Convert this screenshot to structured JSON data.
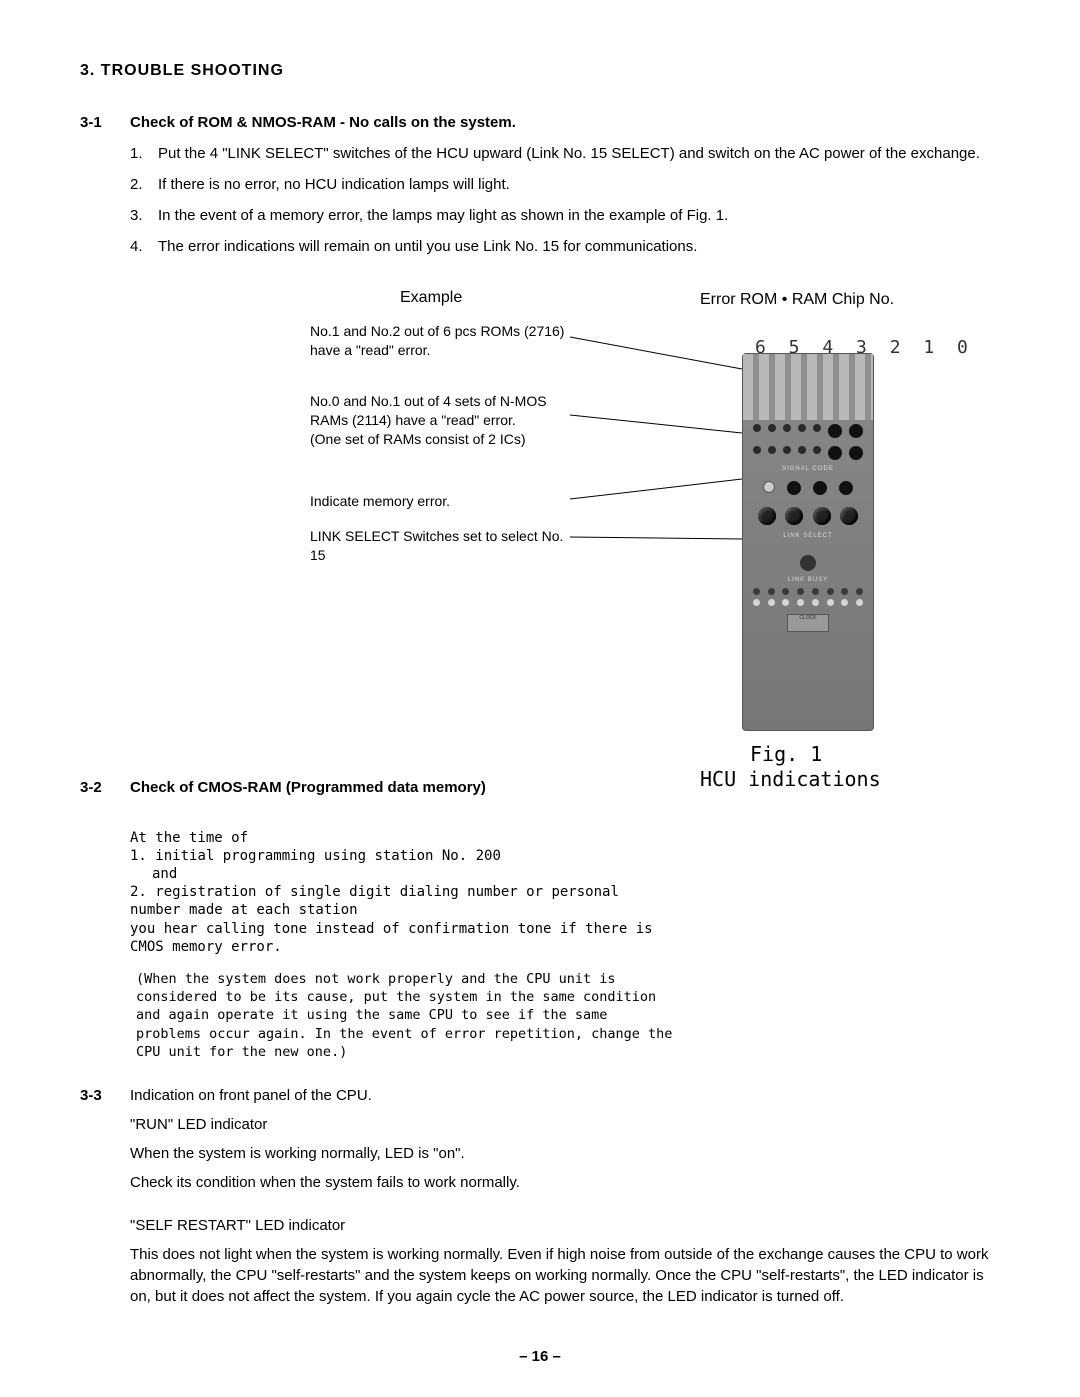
{
  "heading": "3.   TROUBLE  SHOOTING",
  "sec31": {
    "num": "3-1",
    "title": "Check of ROM & NMOS-RAM - No calls on the system.",
    "items": [
      {
        "n": "1.",
        "t": "Put the 4 \"LINK SELECT\" switches of the HCU upward (Link No. 15 SELECT) and switch on the AC power of the exchange."
      },
      {
        "n": "2.",
        "t": "If there is no error, no HCU indication lamps will light."
      },
      {
        "n": "3.",
        "t": "In the event of a memory error, the lamps may light as shown in the example of Fig. 1."
      },
      {
        "n": "4.",
        "t": "The error indications will remain on until you use Link No. 15 for communications."
      }
    ]
  },
  "example": {
    "label": "Example",
    "error_label": "Error ROM • RAM Chip No.",
    "chip_numbers": "6 5 4 3 2 1 0",
    "callouts": [
      "No.1 and No.2 out of 6 pcs ROMs (2716) have a \"read\" error.",
      "No.0 and No.1 out of 4 sets of N-MOS RAMs (2114) have a \"read\" error.\n(One set of RAMs consist of 2 ICs)",
      "Indicate memory error.",
      "LINK SELECT Switches set to select No. 15"
    ],
    "hcu_labels": {
      "signal": "SIGNAL  CODE",
      "link_select": "LINK  SELECT",
      "link_busy": "LINK  BUSY",
      "clock": "CLOCK"
    },
    "fig_label": "Fig. 1",
    "fig_caption": "HCU indications"
  },
  "sec32": {
    "num": "3-2",
    "title": "Check of CMOS-RAM (Programmed data memory)",
    "lead": "At the time of",
    "items": [
      {
        "n": "1.",
        "t": "initial programming using station No. 200",
        "tail": "and"
      },
      {
        "n": "2.",
        "t": "registration of single digit dialing number or personal number made at each station"
      }
    ],
    "trail": "you hear calling tone instead of confirmation tone if there is CMOS memory error.",
    "note": "(When the system does not work properly and the CPU unit is considered to be its cause, put the system in the same condition and again operate it using the same CPU to see if the same problems occur again.  In  the  event of error repetition, change the CPU unit for the new one.)"
  },
  "sec33": {
    "num": "3-3",
    "title": "Indication on front panel of the CPU.",
    "run_head": "\"RUN\" LED indicator",
    "run_l1": "When the system is working normally, LED is \"on\".",
    "run_l2": "Check its condition when the system fails to work normally.",
    "self_head": "\"SELF RESTART\" LED indicator",
    "self_body": "This does not light when the system is working normally.  Even if high noise from outside of the exchange causes the CPU to work abnormally, the CPU \"self-restarts\" and the system keeps on working normally.  Once the CPU \"self-restarts\", the LED indicator is on, but it does not affect the system.  If you again cycle the AC power source, the LED indicator is turned off."
  },
  "page_num": "–  16  –"
}
